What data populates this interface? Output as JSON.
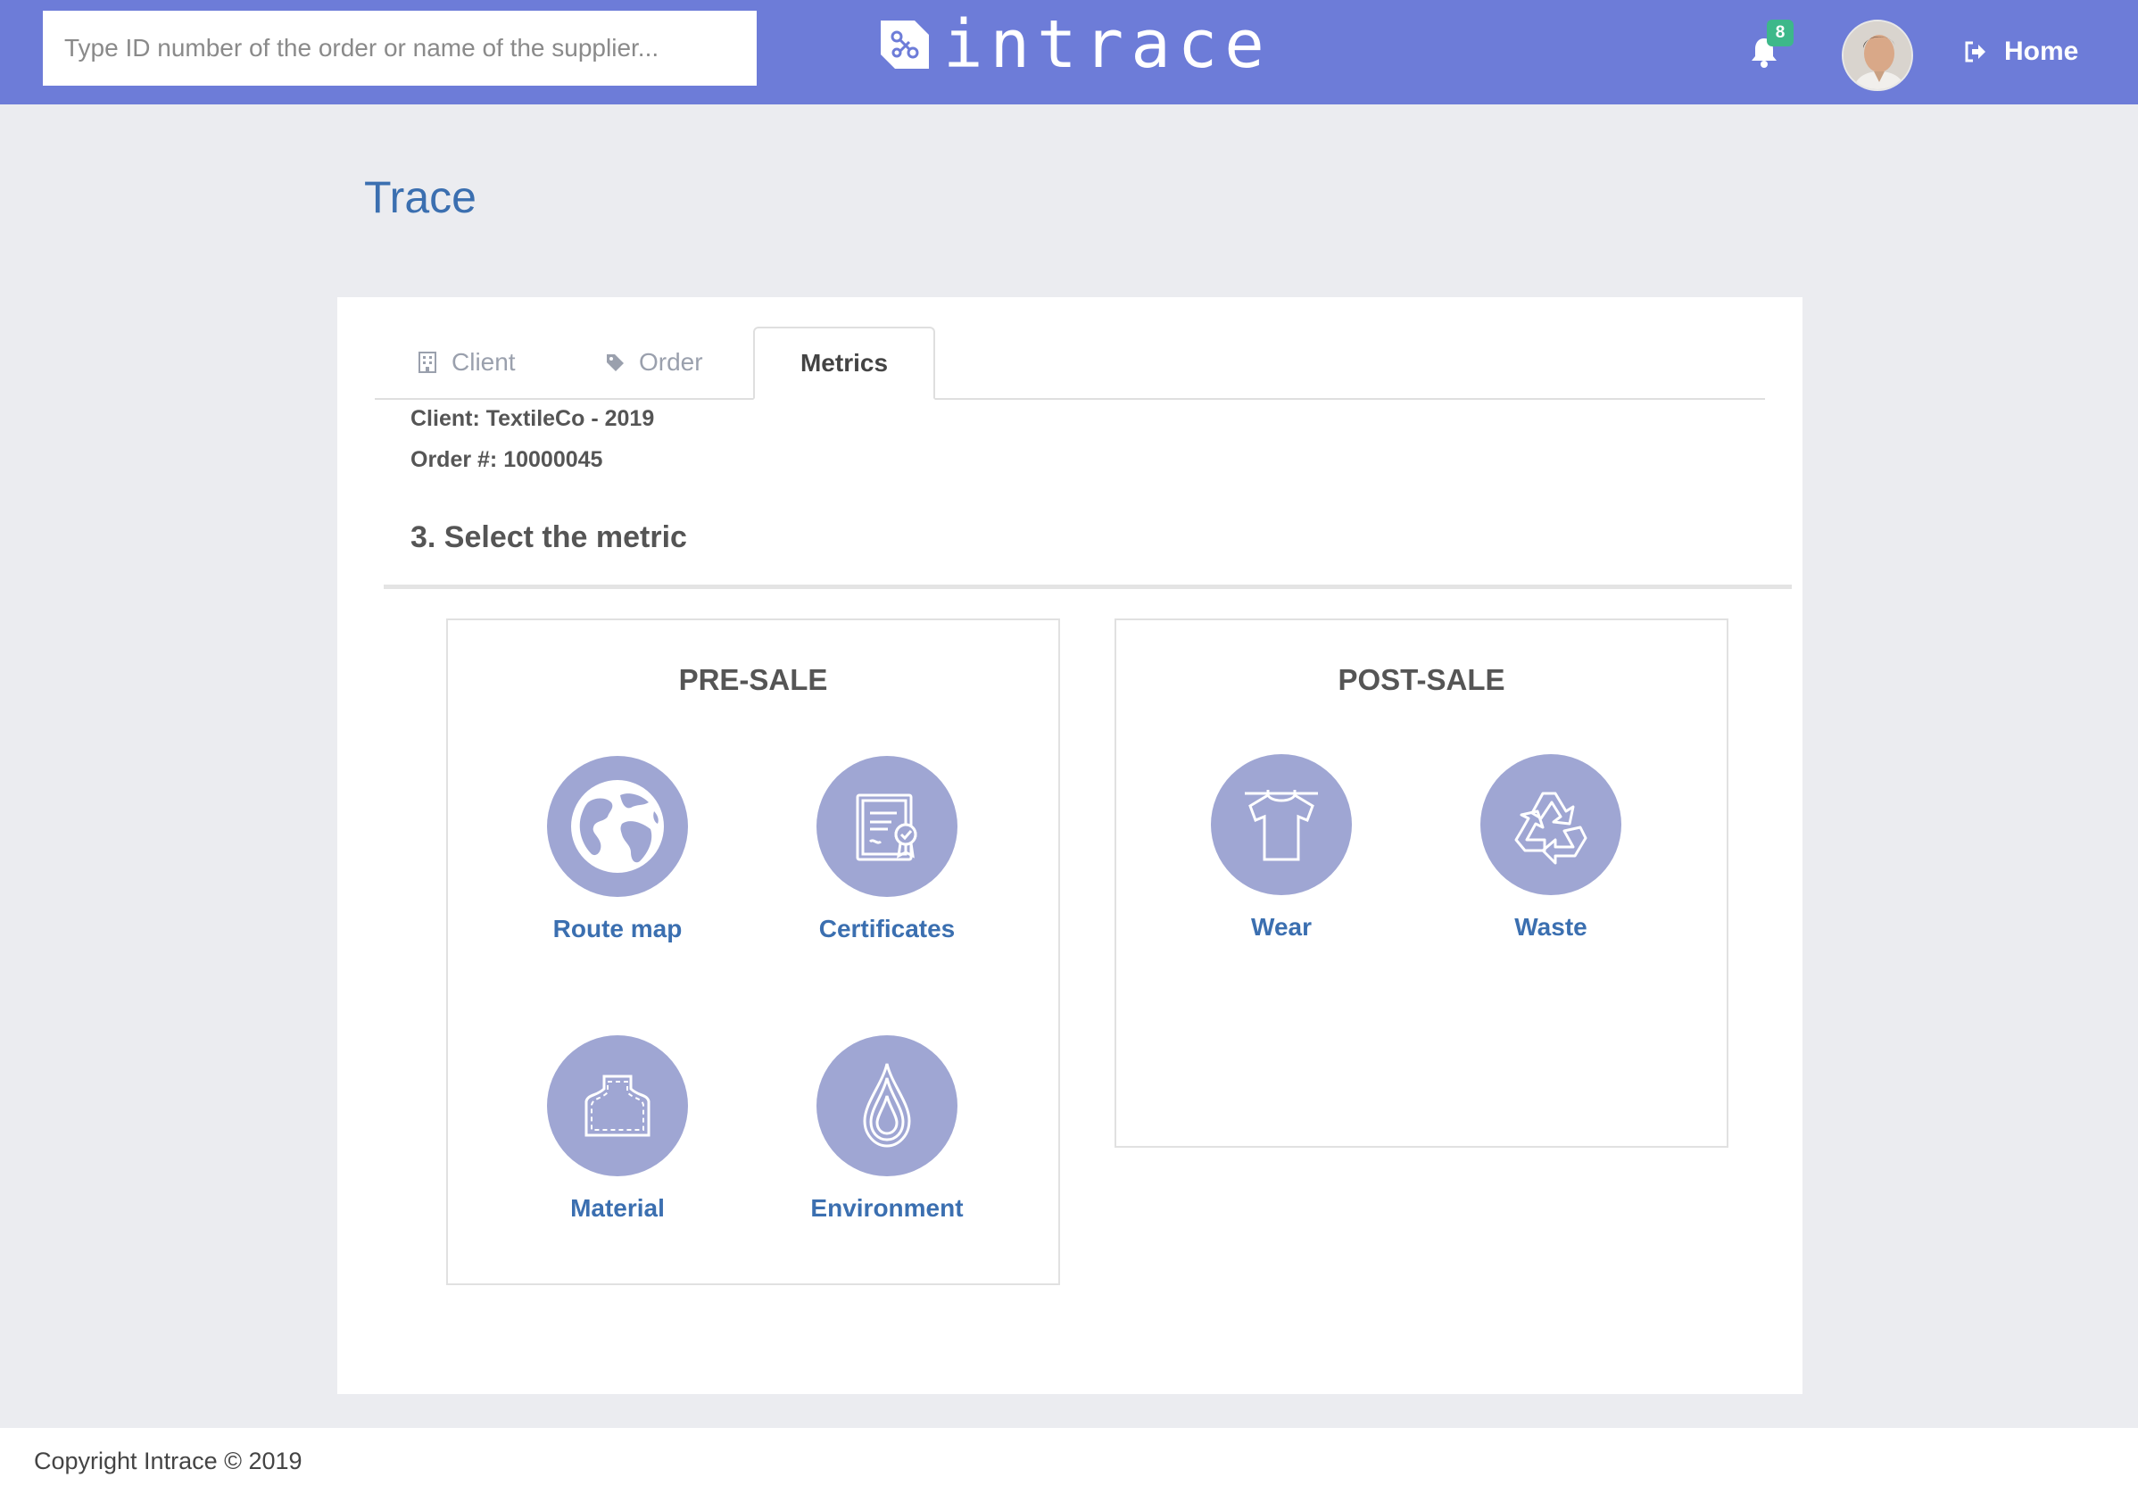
{
  "header": {
    "search_placeholder": "Type ID number of the order or name of the supplier...",
    "logo_text": "intrace",
    "notification_count": "8",
    "home_label": "Home",
    "brand_color": "#6d7cd8"
  },
  "page": {
    "title": "Trace"
  },
  "tabs": [
    {
      "label": "Client",
      "icon": "building-icon",
      "active": false
    },
    {
      "label": "Order",
      "icon": "tag-icon",
      "active": false
    },
    {
      "label": "Metrics",
      "icon": "",
      "active": true
    }
  ],
  "info": {
    "client": "Client: TextileCo - 2019",
    "order": "Order #: 10000045"
  },
  "step_title": "3. Select the metric",
  "pre_sale": {
    "title": "PRE-SALE",
    "items": [
      {
        "label": "Route map",
        "icon": "globe-icon"
      },
      {
        "label": "Certificates",
        "icon": "certificate-icon"
      },
      {
        "label": "Material",
        "icon": "fabric-pattern-icon"
      },
      {
        "label": "Environment",
        "icon": "water-drop-icon"
      }
    ]
  },
  "post_sale": {
    "title": "POST-SALE",
    "items": [
      {
        "label": "Wear",
        "icon": "tshirt-icon"
      },
      {
        "label": "Waste",
        "icon": "recycle-icon"
      }
    ]
  },
  "footer": {
    "copyright": "Copyright Intrace © 2019"
  },
  "colors": {
    "metric_circle": "#9fa6d3",
    "link_blue": "#3b6fb0",
    "badge_green": "#3db88a"
  }
}
